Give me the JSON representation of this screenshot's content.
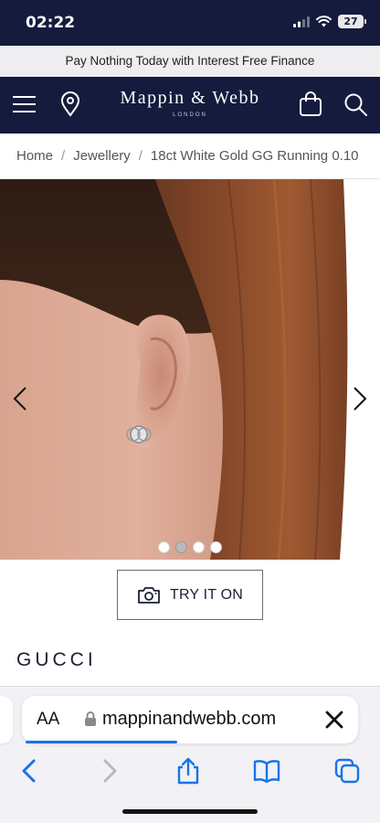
{
  "status": {
    "time": "02:22",
    "battery": "27"
  },
  "promo": {
    "text": "Pay Nothing Today with Interest Free Finance"
  },
  "header": {
    "logo_main": "Mappin & Webb",
    "logo_sub": "LONDON",
    "icons": [
      "menu-icon",
      "location-icon",
      "bag-icon",
      "search-icon"
    ]
  },
  "breadcrumb": {
    "items": [
      "Home",
      "Jewellery",
      "18ct White Gold GG Running 0.10"
    ],
    "separator": "/"
  },
  "gallery": {
    "image_count": 4,
    "active_index": 1
  },
  "try_on": {
    "label": "TRY IT ON"
  },
  "product": {
    "brand": "GUCCI"
  },
  "browser": {
    "text_size_label": "AA",
    "url": "mappinandwebb.com",
    "load_progress": 0.45,
    "accent": "#1a73e8"
  },
  "colors": {
    "navy": "#141b3d",
    "promo_bg": "#eeeef0",
    "browser_blue": "#1a73e8"
  }
}
